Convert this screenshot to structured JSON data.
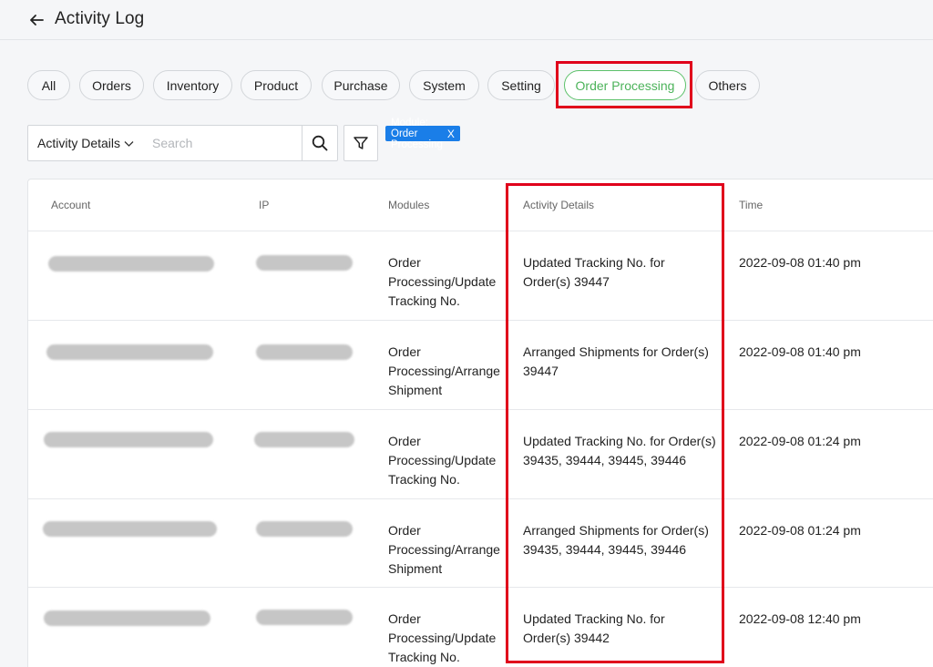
{
  "header": {
    "title": "Activity Log",
    "back_icon": "arrow-left-icon"
  },
  "filters": [
    {
      "label": "All",
      "active": false
    },
    {
      "label": "Orders",
      "active": false
    },
    {
      "label": "Inventory",
      "active": false
    },
    {
      "label": "Product",
      "active": false
    },
    {
      "label": "Purchase",
      "active": false
    },
    {
      "label": "System",
      "active": false
    },
    {
      "label": "Setting",
      "active": false
    },
    {
      "label": "Order Processing",
      "active": true
    },
    {
      "label": "Others",
      "active": false
    }
  ],
  "toolbar": {
    "select_value": "Activity Details",
    "search_placeholder": "Search",
    "search_value": "",
    "tag_label": "Module: Order Processing",
    "tag_close": "X"
  },
  "table": {
    "columns": [
      "Account",
      "IP",
      "Modules",
      "Activity Details",
      "Time"
    ],
    "rows": [
      {
        "module": "Order Processing/Update Tracking No.",
        "details": "Updated Tracking No. for Order(s) 39447",
        "time": "2022-09-08 01:40 pm"
      },
      {
        "module": "Order Processing/Arrange Shipment",
        "details": "Arranged Shipments for Order(s) 39447",
        "time": "2022-09-08 01:40 pm"
      },
      {
        "module": "Order Processing/Update Tracking No.",
        "details": "Updated Tracking No. for Order(s) 39435, 39444, 39445, 39446",
        "time": "2022-09-08 01:24 pm"
      },
      {
        "module": "Order Processing/Arrange Shipment",
        "details": "Arranged Shipments for Order(s) 39435, 39444, 39445, 39446",
        "time": "2022-09-08 01:24 pm"
      },
      {
        "module": "Order Processing/Update Tracking No.",
        "details": "Updated Tracking No. for Order(s) 39442",
        "time": "2022-09-08 12:40 pm"
      }
    ]
  },
  "colors": {
    "accent_green": "#4cb35a",
    "tag_blue": "#1a7ee8",
    "highlight_red": "#e0001b"
  }
}
